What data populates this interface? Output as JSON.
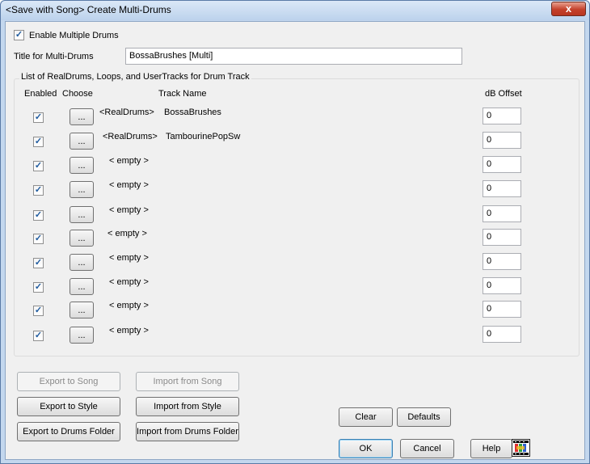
{
  "window": {
    "title": "<Save with Song> Create Multi-Drums",
    "close_glyph": "x"
  },
  "enable_multiple": {
    "label": "Enable Multiple Drums",
    "checked": true
  },
  "title_field": {
    "label": "Title for Multi-Drums",
    "value": "BossaBrushes [Multi]"
  },
  "list": {
    "group_title": "List of RealDrums, Loops, and UserTracks for Drum Track",
    "headers": {
      "enabled": "Enabled",
      "choose": "Choose",
      "track_name": "Track Name",
      "db_offset": "dB Offset"
    },
    "choose_label": "...",
    "rows": [
      {
        "enabled": true,
        "type": "<RealDrums>",
        "name": "BossaBrushes",
        "db": "0"
      },
      {
        "enabled": true,
        "type": "<RealDrums>",
        "name": "TambourinePopSw",
        "db": "0"
      },
      {
        "enabled": true,
        "type": "",
        "name": "< empty >",
        "db": "0"
      },
      {
        "enabled": true,
        "type": "",
        "name": "< empty >",
        "db": "0"
      },
      {
        "enabled": true,
        "type": "",
        "name": "< empty >",
        "db": "0"
      },
      {
        "enabled": true,
        "type": "",
        "name": "< empty >",
        "db": "0"
      },
      {
        "enabled": true,
        "type": "",
        "name": "< empty >",
        "db": "0"
      },
      {
        "enabled": true,
        "type": "",
        "name": "< empty >",
        "db": "0"
      },
      {
        "enabled": true,
        "type": "",
        "name": "< empty >",
        "db": "0"
      },
      {
        "enabled": true,
        "type": "",
        "name": "< empty >",
        "db": "0"
      }
    ]
  },
  "buttons": {
    "export_song": "Export to Song",
    "import_song": "Import from Song",
    "export_style": "Export to Style",
    "import_style": "Import from Style",
    "export_folder": "Export to  Drums Folder",
    "import_folder": "Import from  Drums Folder",
    "clear": "Clear",
    "defaults": "Defaults",
    "ok": "OK",
    "cancel": "Cancel",
    "help": "Help"
  }
}
